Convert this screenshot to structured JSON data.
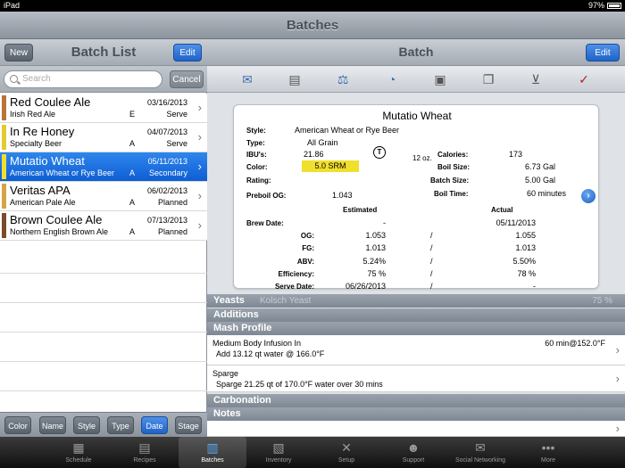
{
  "statusbar": {
    "carrier": "iPad",
    "time": "",
    "battery": "97%"
  },
  "app": {
    "title": "Batches"
  },
  "left": {
    "title": "Batch List",
    "new_label": "New",
    "edit_label": "Edit",
    "search_placeholder": "Search",
    "cancel_label": "Cancel",
    "batches": [
      {
        "name": "Red Coulee Ale",
        "style": "Irish Red Ale",
        "flag": "E",
        "date": "03/16/2013",
        "stage": "Serve",
        "color": "#b8743a"
      },
      {
        "name": "In Re Honey",
        "style": "Specialty Beer",
        "flag": "A",
        "date": "04/07/2013",
        "stage": "Serve",
        "color": "#e2cb2e"
      },
      {
        "name": "Mutatio Wheat",
        "style": "American Wheat or Rye Beer",
        "flag": "A",
        "date": "05/11/2013",
        "stage": "Secondary",
        "color": "#f3de2c"
      },
      {
        "name": "Veritas APA",
        "style": "American Pale Ale",
        "flag": "A",
        "date": "06/02/2013",
        "stage": "Planned",
        "color": "#d4a447"
      },
      {
        "name": "Brown Coulee Ale",
        "style": "Northern English Brown Ale",
        "flag": "A",
        "date": "07/13/2013",
        "stage": "Planned",
        "color": "#7a4a2a"
      }
    ],
    "sort_buttons": [
      "Color",
      "Name",
      "Style",
      "Type",
      "Date",
      "Stage"
    ]
  },
  "right": {
    "title": "Batch",
    "edit_label": "Edit",
    "toolbar_icons": [
      "email-icon",
      "print-icon",
      "scale-icon",
      "timer-icon",
      "camera-icon",
      "document-icon",
      "cart-icon",
      "checklist-icon"
    ],
    "recipe": {
      "name": "Mutatio Wheat",
      "style_label": "Style:",
      "style": "American Wheat or Rye Beer",
      "type_label": "Type:",
      "type": "All Grain",
      "ibu_label": "IBU's:",
      "ibu": "21.86",
      "color_label": "Color:",
      "color": "5.0 SRM",
      "rating_label": "Rating:",
      "preboil_label": "Preboil OG:",
      "preboil": "1.043",
      "serving": "12 oz.",
      "calories_label": "Calories:",
      "calories": "173",
      "boil_size_label": "Boil Size:",
      "boil_size": "6.73 Gal",
      "batch_size_label": "Batch Size:",
      "batch_size": "5.00 Gal",
      "boil_time_label": "Boil Time:",
      "boil_time": "60 minutes",
      "estimated_header": "Estimated",
      "actual_header": "Actual",
      "rows": [
        {
          "label": "Brew Date:",
          "est": "-",
          "sep": "",
          "act": "05/11/2013"
        },
        {
          "label": "OG:",
          "est": "1.053",
          "sep": "/",
          "act": "1.055"
        },
        {
          "label": "FG:",
          "est": "1.013",
          "sep": "/",
          "act": "1.013"
        },
        {
          "label": "ABV:",
          "est": "5.24%",
          "sep": "/",
          "act": "5.50%"
        },
        {
          "label": "Efficiency:",
          "est": "75 %",
          "sep": "/",
          "act": "78 %"
        },
        {
          "label": "Serve Date:",
          "est": "06/26/2013",
          "sep": "/",
          "act": "-"
        }
      ]
    },
    "sections": {
      "yeasts": "Yeasts",
      "yeasts_item": "Kolsch Yeast",
      "yeasts_pct": "75 %",
      "additions": "Additions",
      "mash": "Mash Profile",
      "mash_step1_title": "Medium Body Infusion In",
      "mash_step1_detail": "Add 13.12 qt water @ 166.0°F",
      "mash_step1_time": "60 min@152.0°F",
      "mash_step2_title": "Sparge",
      "mash_step2_detail": "Sparge 21.25 qt of 170.0°F water over 30 mins",
      "carbonation": "Carbonation",
      "notes": "Notes"
    }
  },
  "tabs": [
    {
      "label": "Schedule",
      "icon": "calendar-icon",
      "glyph": "▦"
    },
    {
      "label": "Recipes",
      "icon": "recipes-icon",
      "glyph": "▤"
    },
    {
      "label": "Batches",
      "icon": "beer-glass-icon",
      "glyph": "▥",
      "active": true
    },
    {
      "label": "Inventory",
      "icon": "inventory-icon",
      "glyph": "▧"
    },
    {
      "label": "Setup",
      "icon": "tools-icon",
      "glyph": "✕"
    },
    {
      "label": "Support",
      "icon": "support-icon",
      "glyph": "☻"
    },
    {
      "label": "Social Networking",
      "icon": "chat-icon",
      "glyph": "✉"
    },
    {
      "label": "More",
      "icon": "more-icon",
      "glyph": "•••"
    }
  ]
}
